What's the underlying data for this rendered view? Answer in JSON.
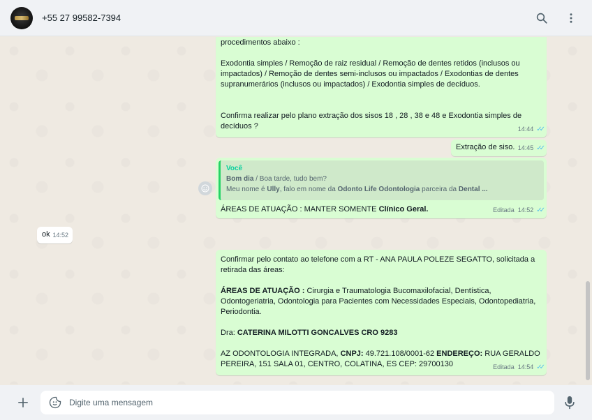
{
  "header": {
    "contact_name": "+55 27 99582-7394",
    "icons": [
      "search-icon",
      "menu-icon"
    ]
  },
  "messages": {
    "m1": {
      "line1": "procedimentos abaixo :",
      "line2": "Exodontia simples / Remoção de raiz residual  /  Remoção de dentes retidos (inclusos ou",
      "line3": "impactados) /  Remoção de dentes semi-inclusos ou  impactados /  Exodontias de dentes",
      "line4": "supranumerários (inclusos ou impactados) /  Exodontia simples de decíduos.",
      "line5": "Confirma realizar pelo plano  extração dos sisos 18 , 28 , 38 e 48 e Exodontia simples de",
      "line6": "decíduos ?",
      "time": "14:44"
    },
    "m2": {
      "text": "Extração de siso.",
      "time": "14:45"
    },
    "m3": {
      "quote_author": "Você",
      "quote_line1_bold": "Bom dia",
      "quote_line1_rest": " / Boa tarde, tudo bem?",
      "quote_line2_a": "Meu nome é ",
      "quote_line2_b": "Ully",
      "quote_line2_c": ", falo em nome da ",
      "quote_line2_d": "Odonto Life Odontologia",
      "quote_line2_e": " parceira da ",
      "quote_line2_f": "Dental ...",
      "text_a": "ÁREAS DE ATUAÇÃO : MANTER SOMENTE ",
      "text_b": "Clínico Geral.",
      "edited": "Editada",
      "time": "14:52"
    },
    "m4": {
      "text": "ok",
      "time": "14:52"
    },
    "m5": {
      "line1": "Confirmar pelo contato ao telefone com a RT - ANA PAULA POLEZE SEGATTO, solicitada a",
      "line2": "retirada das áreas:",
      "areas_label": "ÁREAS DE ATUAÇÃO :",
      "areas_line1": " Cirurgia e Traumatologia Bucomaxilofacial, Dentística,",
      "areas_line2": "Odontogeriatria, Odontologia para Pacientes com Necessidades Especiais, Odontopediatria,",
      "areas_line3": "Periodontia.",
      "dra_label": "Dra: ",
      "dra_name": "CATERINA MILOTTI GONCALVES CRO 9283",
      "company": " AZ ODONTOLOGIA INTEGRADA,  ",
      "cnpj_label": "CNPJ:",
      "cnpj_value": " 49.721.108/0001-62 ",
      "endereco_label": "ENDEREÇO:",
      "endereco_value1": " RUA GERALDO",
      "endereco_value2": "PEREIRA, 151 SALA 01, CENTRO, COLATINA, ES CEP: 29700130",
      "edited": "Editada",
      "time": "14:54"
    }
  },
  "footer": {
    "placeholder": "Digite uma mensagem"
  },
  "colors": {
    "outgoing_bubble": "#d9fdd3",
    "incoming_bubble": "#ffffff",
    "read_ticks": "#53bdeb",
    "chat_background": "#efeae2"
  }
}
